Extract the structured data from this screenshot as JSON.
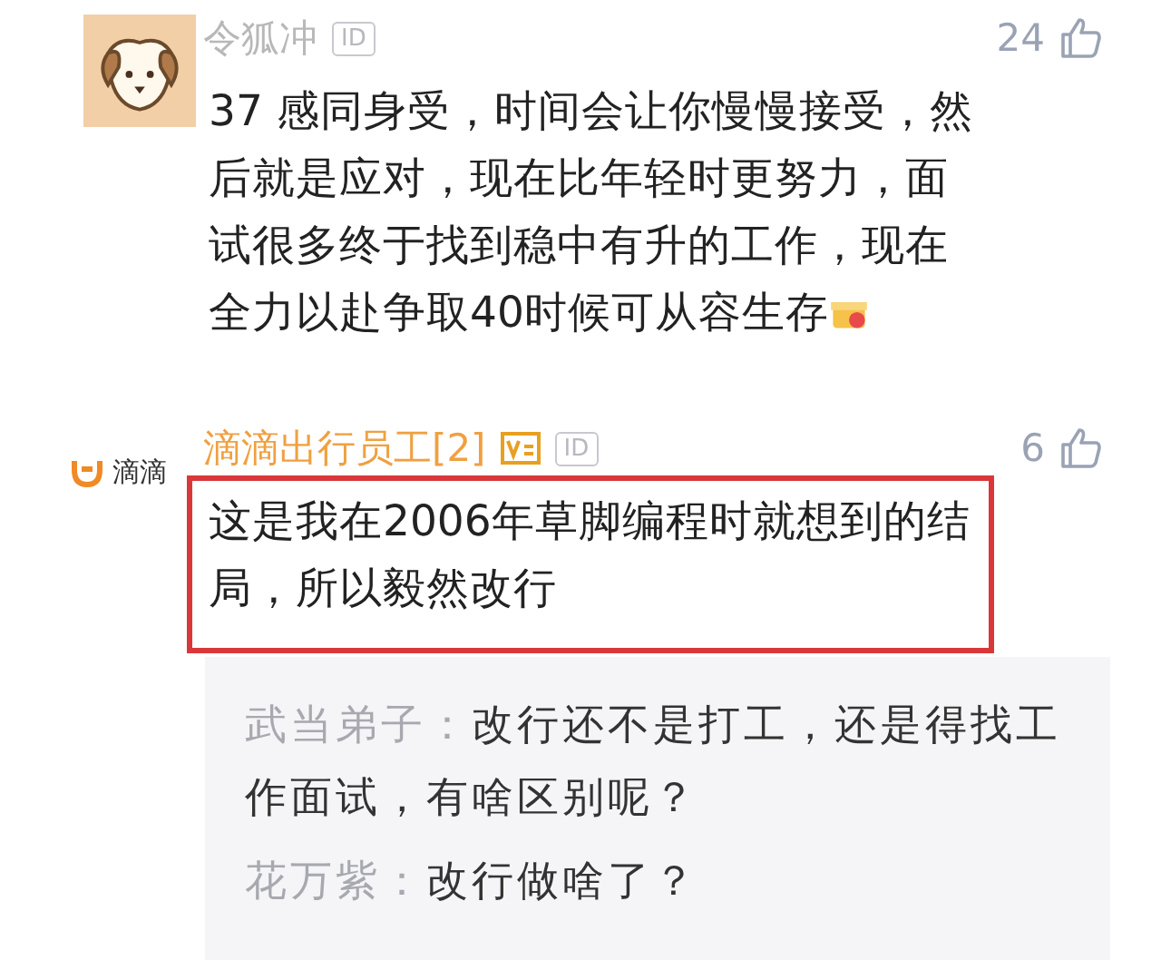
{
  "comments": [
    {
      "kind": "avatar",
      "author": "令狐冲",
      "verified": false,
      "id_badge": "ID",
      "likes": "24",
      "text": "37 感同身受，时间会让你慢慢接受，然后就是应对，现在比年轻时更努力，面试很多终于找到稳中有升的工作，现在全力以赴争取40时候可从容生存",
      "gift_emoji": true,
      "highlighted": false
    },
    {
      "kind": "company",
      "company_label": "滴滴",
      "author": "滴滴出行员工[2]",
      "verified": true,
      "id_badge": "ID",
      "likes": "6",
      "text": "这是我在2006年草脚编程时就想到的结局，所以毅然改行",
      "gift_emoji": false,
      "highlighted": true,
      "replies": [
        {
          "author": "武当弟子：",
          "text": "改行还不是打工，还是得找工作面试，有啥区别呢？"
        },
        {
          "author": "花万紫：",
          "text": "改行做啥了？"
        }
      ]
    }
  ]
}
